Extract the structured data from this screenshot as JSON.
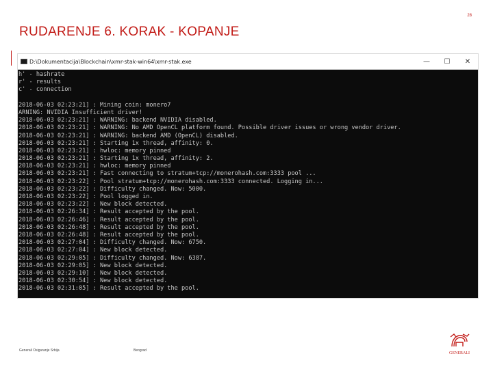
{
  "slide": {
    "number": "28",
    "title": "RUDARENJE 6. KORAK - KOPANJE"
  },
  "window": {
    "title": "D:\\Dokumentacija\\Blockchain\\xmr-stak-win64\\xmr-stak.exe",
    "icon": "cmd-icon",
    "controls": {
      "minimize": "—",
      "maximize": "☐",
      "close": "✕"
    }
  },
  "console": {
    "lines": [
      "h' - hashrate",
      "r' - results",
      "c' - connection",
      "",
      "2018-06-03 02:23:21] : Mining coin: monero7",
      "ARNING: NVIDIA Insufficient driver!",
      "2018-06-03 02:23:21] : WARNING: backend NVIDIA disabled.",
      "2018-06-03 02:23:21] : WARNING: No AMD OpenCL platform found. Possible driver issues or wrong vendor driver.",
      "2018-06-03 02:23:21] : WARNING: backend AMD (OpenCL) disabled.",
      "2018-06-03 02:23:21] : Starting 1x thread, affinity: 0.",
      "2018-06-03 02:23:21] : hwloc: memory pinned",
      "2018-06-03 02:23:21] : Starting 1x thread, affinity: 2.",
      "2018-06-03 02:23:21] : hwloc: memory pinned",
      "2018-06-03 02:23:21] : Fast connecting to stratum+tcp://monerohash.com:3333 pool ...",
      "2018-06-03 02:23:22] : Pool stratum+tcp://monerohash.com:3333 connected. Logging in...",
      "2018-06-03 02:23:22] : Difficulty changed. Now: 5000.",
      "2018-06-03 02:23:22] : Pool logged in.",
      "2018-06-03 02:23:22] : New block detected.",
      "2018-06-03 02:26:34] : Result accepted by the pool.",
      "2018-06-03 02:26:46] : Result accepted by the pool.",
      "2018-06-03 02:26:48] : Result accepted by the pool.",
      "2018-06-03 02:26:48] : Result accepted by the pool.",
      "2018-06-03 02:27:04] : Difficulty changed. Now: 6750.",
      "2018-06-03 02:27:04] : New block detected.",
      "2018-06-03 02:29:05] : Difficulty changed. Now: 6387.",
      "2018-06-03 02:29:05] : New block detected.",
      "2018-06-03 02:29:10] : New block detected.",
      "2018-06-03 02:30:54] : New block detected.",
      "2018-06-03 02:31:05] : Result accepted by the pool."
    ]
  },
  "footer": {
    "company": "Generali Osiguranje Srbija",
    "city": "Beograd",
    "logo_text": "GENERALI"
  },
  "colors": {
    "accent": "#c21b17",
    "console_bg": "#0c0c0c",
    "console_text": "#c8c8c8"
  }
}
